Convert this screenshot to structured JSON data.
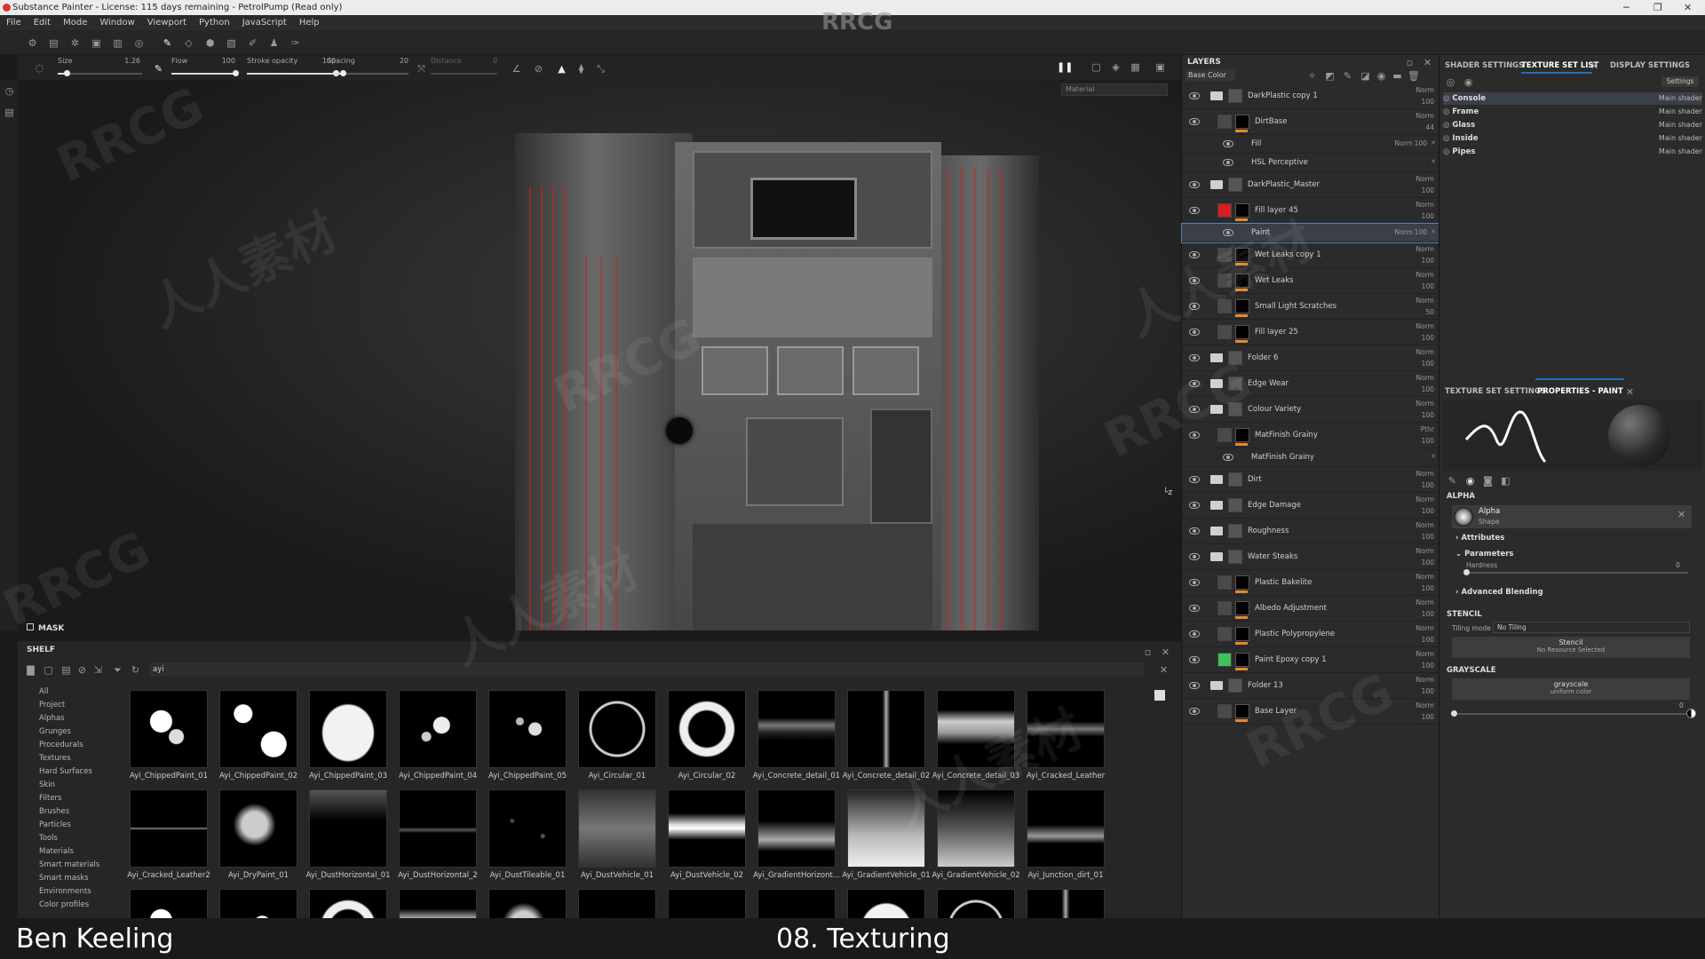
{
  "window": {
    "title": "Substance Painter - License: 115 days remaining - PetrolPump (Read only)"
  },
  "menu": [
    "File",
    "Edit",
    "Mode",
    "Window",
    "Viewport",
    "Python",
    "JavaScript",
    "Help"
  ],
  "watermark": {
    "top": "RRCG",
    "text1": "RRCG",
    "text2": "人人素材"
  },
  "brush": {
    "size_label": "Size",
    "size_value": "1.26",
    "size_level": 0.1,
    "flow_label": "Flow",
    "flow_value": "100",
    "flow_level": 1.0,
    "stroke_label": "Stroke opacity",
    "stroke_value": "100",
    "stroke_level": 1.0,
    "spacing_label": "Spacing",
    "spacing_value": "20",
    "spacing_level": 0.2,
    "distance_label": "Distance",
    "distance_value": "0"
  },
  "viewport": {
    "channel": "Material"
  },
  "mask": {
    "label": "MASK"
  },
  "shelf": {
    "title": "SHELF",
    "search": "ayi",
    "categories": [
      "All",
      "Project",
      "Alphas",
      "Grunges",
      "Procedurals",
      "Textures",
      "Hard Surfaces",
      "Skin",
      "Filters",
      "Brushes",
      "Particles",
      "Tools",
      "Materials",
      "Smart materials",
      "Smart masks",
      "Environments",
      "Color profiles"
    ],
    "items": [
      "Ayi_ChippedPaint_01",
      "Ayi_ChippedPaint_02",
      "Ayi_ChippedPaint_03",
      "Ayi_ChippedPaint_04",
      "Ayi_ChippedPaint_05",
      "Ayi_Circular_01",
      "Ayi_Circular_02",
      "Ayi_Concrete_detail_01",
      "Ayi_Concrete_detail_02",
      "Ayi_Concrete_detail_03",
      "Ayi_Cracked_Leather",
      "Ayi_Cracked_Leather2",
      "Ayi_DryPaint_01",
      "Ayi_DustHorizontal_01",
      "Ayi_DustHorizontal_2",
      "Ayi_DustTileable_01",
      "Ayi_DustVehicle_01",
      "Ayi_DustVehicle_02",
      "Ayi_GradientHorizont...",
      "Ayi_GradientVehicle_01",
      "Ayi_GradientVehicle_02",
      "Ayi_Junction_dirt_01"
    ]
  },
  "layers": {
    "title": "LAYERS",
    "channel": "Base Color",
    "rows": [
      {
        "name": "DarkPlastic copy 1",
        "blend": "Norm",
        "opacity": "100",
        "kind": "folder"
      },
      {
        "name": "DirtBase",
        "blend": "Norm",
        "opacity": "44",
        "kind": "layer"
      },
      {
        "name": "Fill",
        "blend": "Norm",
        "opacity": "100",
        "kind": "effect"
      },
      {
        "name": "HSL Perceptive",
        "blend": "",
        "opacity": "",
        "kind": "effect"
      },
      {
        "name": "DarkPlastic_Master",
        "blend": "Norm",
        "opacity": "100",
        "kind": "folder"
      },
      {
        "name": "Fill layer 45",
        "blend": "Norm",
        "opacity": "100",
        "kind": "layer"
      },
      {
        "name": "Paint",
        "blend": "Norm",
        "opacity": "100",
        "kind": "effect"
      },
      {
        "name": "Wet Leaks copy 1",
        "blend": "Norm",
        "opacity": "100",
        "kind": "layer"
      },
      {
        "name": "Wet Leaks",
        "blend": "Norm",
        "opacity": "100",
        "kind": "layer"
      },
      {
        "name": "Small Light Scratches",
        "blend": "Norm",
        "opacity": "50",
        "kind": "layer"
      },
      {
        "name": "Fill layer 25",
        "blend": "Norm",
        "opacity": "100",
        "kind": "layer"
      },
      {
        "name": "Folder 6",
        "blend": "Norm",
        "opacity": "100",
        "kind": "folder"
      },
      {
        "name": "Edge Wear",
        "blend": "Norm",
        "opacity": "100",
        "kind": "folder"
      },
      {
        "name": "Colour Variety",
        "blend": "Norm",
        "opacity": "100",
        "kind": "folder"
      },
      {
        "name": "MatFinish Grainy",
        "blend": "Pthr",
        "opacity": "100",
        "kind": "layer"
      },
      {
        "name": "MatFinish Grainy",
        "blend": "",
        "opacity": "",
        "kind": "effect"
      },
      {
        "name": "Dirt",
        "blend": "Norm",
        "opacity": "100",
        "kind": "folder"
      },
      {
        "name": "Edge Damage",
        "blend": "Norm",
        "opacity": "100",
        "kind": "folder"
      },
      {
        "name": "Roughness",
        "blend": "Norm",
        "opacity": "100",
        "kind": "folder"
      },
      {
        "name": "Water Steaks",
        "blend": "Norm",
        "opacity": "100",
        "kind": "folder"
      },
      {
        "name": "Plastic Bakelite",
        "blend": "Norm",
        "opacity": "100",
        "kind": "layer"
      },
      {
        "name": "Albedo Adjustment",
        "blend": "Norm",
        "opacity": "100",
        "kind": "layer"
      },
      {
        "name": "Plastic Polypropylene",
        "blend": "Norm",
        "opacity": "100",
        "kind": "layer"
      },
      {
        "name": "Paint Epoxy copy 1",
        "blend": "Norm",
        "opacity": "100",
        "kind": "layer"
      },
      {
        "name": "Folder 13",
        "blend": "Norm",
        "opacity": "100",
        "kind": "folder"
      },
      {
        "name": "Base Layer",
        "blend": "Norm",
        "opacity": "100",
        "kind": "layer"
      }
    ]
  },
  "right": {
    "tabs": [
      "SHADER SETTINGS",
      "TEXTURE SET LIST",
      "DISPLAY SETTINGS"
    ],
    "settings_btn": "Settings",
    "texture_sets": [
      {
        "name": "Console",
        "shader": "Main shader"
      },
      {
        "name": "Frame",
        "shader": "Main shader"
      },
      {
        "name": "Glass",
        "shader": "Main shader"
      },
      {
        "name": "Inside",
        "shader": "Main shader"
      },
      {
        "name": "Pipes",
        "shader": "Main shader"
      }
    ],
    "tabs2": [
      "TEXTURE SET SETTINGS",
      "PROPERTIES - PAINT"
    ],
    "alpha_section": "ALPHA",
    "alpha_name": "Alpha",
    "alpha_sub": "Shape",
    "attributes": "Attributes",
    "parameters": "Parameters",
    "hardness_label": "Hardness",
    "hardness_value": "0",
    "advanced": "Advanced Blending",
    "stencil_section": "STENCIL",
    "tiling_label": "Tiling mode",
    "tiling_value": "No Tiling",
    "stencil_btn": "Stencil",
    "stencil_sub": "No Resource Selected",
    "grayscale_section": "GRAYSCALE",
    "grayscale_btn": "grayscale",
    "grayscale_sub": "uniform color",
    "grayscale_value": "0"
  },
  "caption": {
    "author": "Ben Keeling",
    "lesson": "08. Texturing"
  }
}
